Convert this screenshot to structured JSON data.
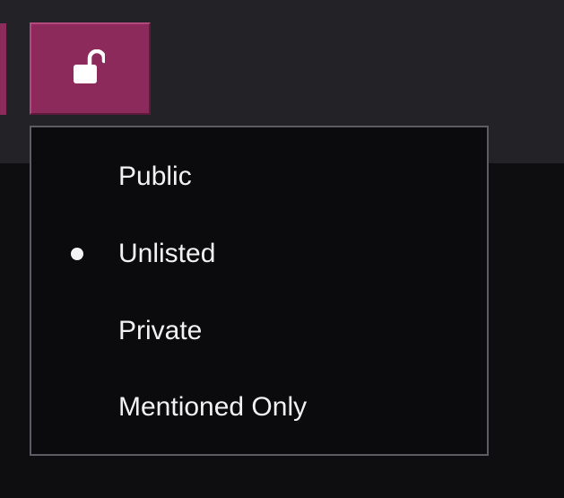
{
  "toolbar": {
    "visibility_button_icon": "unlock-icon",
    "accent_color": "#8c2a5b"
  },
  "visibility_menu": {
    "selected": "Unlisted",
    "items": [
      {
        "label": "Public",
        "selected": false
      },
      {
        "label": "Unlisted",
        "selected": true
      },
      {
        "label": "Private",
        "selected": false
      },
      {
        "label": "Mentioned Only",
        "selected": false
      }
    ]
  }
}
